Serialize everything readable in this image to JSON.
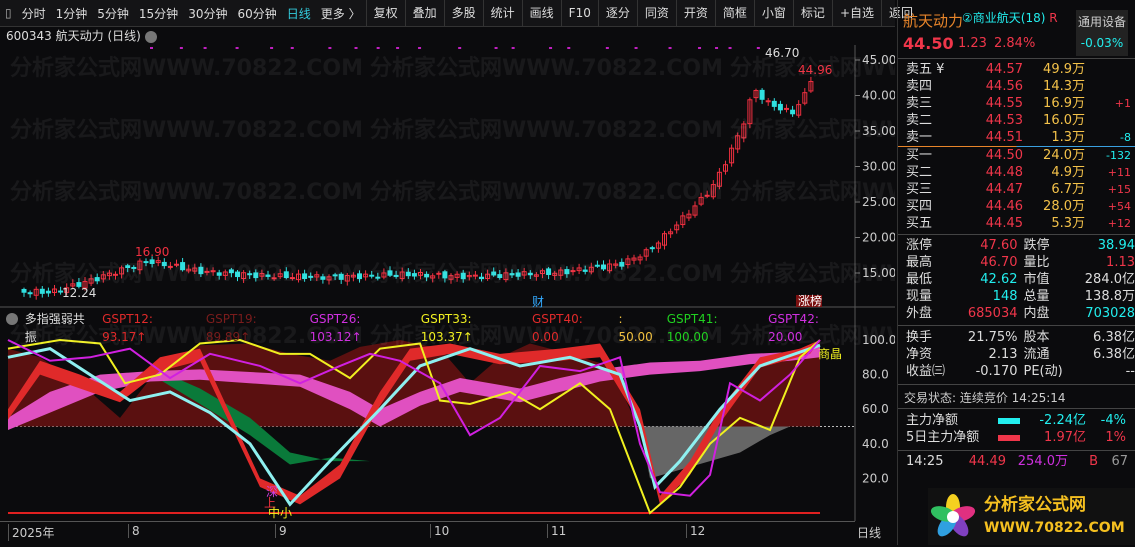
{
  "menu": {
    "items": [
      "分时",
      "1分钟",
      "5分钟",
      "15分钟",
      "30分钟",
      "60分钟",
      "日线",
      "更多 〉"
    ],
    "buttons": [
      "复权",
      "叠加",
      "多股",
      "统计",
      "画线",
      "F10",
      "逐分",
      "同资",
      "开资",
      "简框",
      "小窗",
      "标记",
      "+自选",
      "返回"
    ]
  },
  "title": "600343 航天动力 (日线)",
  "main_chart": {
    "y_ticks": [
      "45.00",
      "40.00",
      "35.00",
      "30.00",
      "25.00",
      "20.00",
      "15.00"
    ],
    "high_label": "46.70",
    "cur_label": "44.96",
    "peak_label": "16.90",
    "low_label": "12.24",
    "marker_cai": "财",
    "marker_zhang": "涨榜"
  },
  "indicator": {
    "name": "多指强弱共振",
    "values": [
      {
        "t": "GSPT12: 93.17↑",
        "c": "#e02a2a"
      },
      {
        "t": "GSPT19: 89.89↑",
        "c": "#7a1c1c"
      },
      {
        "t": "GSPT26: 103.12↑",
        "c": "#d030e0"
      },
      {
        "t": "GSPT33: 103.37↑",
        "c": "#f0f020"
      },
      {
        "t": "GSPT40: 0.00",
        "c": "#e02a2a"
      },
      {
        "t": ": 50.00",
        "c": "#f0c040"
      },
      {
        "t": "GSPT41: 100.00",
        "c": "#20d020"
      },
      {
        "t": "GSPT42: 20.00",
        "c": "#d030e0"
      }
    ],
    "y_ticks": [
      "100.0",
      "80.0",
      "60.0",
      "40.0",
      "20.0"
    ],
    "labels": [
      "上",
      "深",
      "中小",
      "商晶"
    ]
  },
  "x_axis": {
    "labels": [
      "2025年",
      "8",
      "9",
      "10",
      "11",
      "12"
    ],
    "period": "日线"
  },
  "quote": {
    "name": "航天动力",
    "sector": "②商业航天",
    "sector_count": "(18)",
    "r": "R",
    "sector_box": "通用设备",
    "sector_pct": "-0.03%",
    "price": "44.50",
    "change": "1.23",
    "pct": "2.84%"
  },
  "asks": [
    [
      "卖五 ¥",
      "44.57",
      "49.9万",
      ""
    ],
    [
      "卖四",
      "44.56",
      "14.3万",
      ""
    ],
    [
      "卖三",
      "44.55",
      "16.9万",
      "+1"
    ],
    [
      "卖二",
      "44.53",
      "16.0万",
      ""
    ],
    [
      "卖一",
      "44.51",
      "1.3万",
      "-8"
    ]
  ],
  "bids": [
    [
      "买一",
      "44.50",
      "24.0万",
      "-132"
    ],
    [
      "买二",
      "44.48",
      "4.9万",
      "+11"
    ],
    [
      "买三",
      "44.47",
      "6.7万",
      "+15"
    ],
    [
      "买四",
      "44.46",
      "28.0万",
      "+54"
    ],
    [
      "买五",
      "44.45",
      "5.3万",
      "+12"
    ]
  ],
  "stats1": [
    [
      "涨停",
      "47.60",
      "red",
      "跌停",
      "38.94",
      "cyan"
    ],
    [
      "最高",
      "46.70",
      "red",
      "量比",
      "1.13",
      "red"
    ],
    [
      "最低",
      "42.62",
      "cyan",
      "市值",
      "284.0亿",
      "wh"
    ],
    [
      "现量",
      "148",
      "cyan",
      "总量",
      "138.8万",
      "wh"
    ],
    [
      "外盘",
      "685034",
      "red",
      "内盘",
      "703028",
      "cyan"
    ]
  ],
  "stats2": [
    [
      "换手",
      "21.75%",
      "股本",
      "6.38亿"
    ],
    [
      "净资",
      "2.13",
      "流通",
      "6.38亿"
    ],
    [
      "收益㈢",
      "-0.170",
      "PE(动)",
      "--"
    ]
  ],
  "status": "交易状态: 连续竞价 14:25:14",
  "flow": [
    {
      "label": "主力净额",
      "val": "-2.24亿",
      "pct": "-4%",
      "color": "#2ee"
    },
    {
      "label": "5日主力净额",
      "val": "1.97亿",
      "pct": "1%",
      "color": "#f0364a"
    }
  ],
  "ticks": [
    [
      "14:25",
      "44.49",
      "254.0万",
      "B",
      "67"
    ]
  ],
  "watermark": "分析家公式网 WWW.70822.COM"
}
